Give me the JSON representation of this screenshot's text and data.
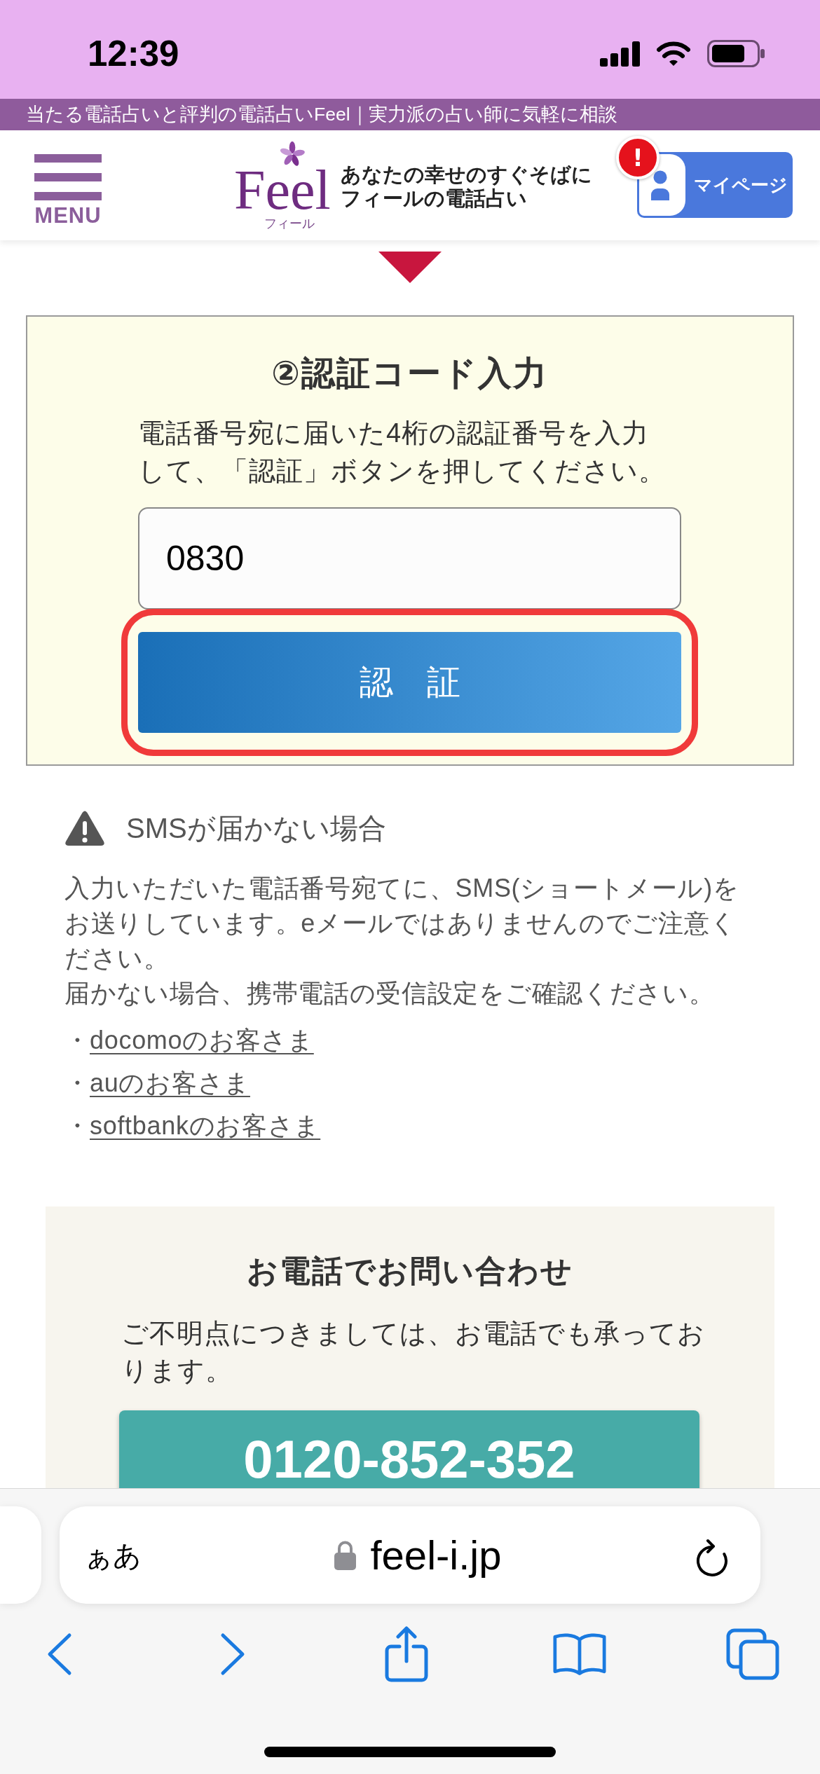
{
  "status_bar": {
    "time": "12:39"
  },
  "site_banner": {
    "text": "当たる電話占いと評判の電話占いFeel｜実力派の占い師に気軽に相談"
  },
  "header": {
    "menu_button": {
      "label": "MENU"
    },
    "logo": {
      "wordmark": "Feel",
      "reading": "フィール",
      "tagline": "あなたの幸せのすぐそばにフィールの電話占い"
    },
    "mypage_button": {
      "label": "マイページ",
      "badge": "!"
    }
  },
  "verification": {
    "title": "②認証コード入力",
    "instructions": "電話番号宛に届いた4桁の認証番号を入力して、「認証」ボタンを押してください。",
    "code_field": {
      "value": "0830"
    },
    "submit_button": {
      "label": "認　証",
      "highlighted": true
    }
  },
  "sms_help": {
    "heading": "SMSが届かない場合",
    "paragraphs": [
      "入力いただいた電話番号宛てに、SMS(ショートメール)をお送りしています。eメールではありませんのでご注意ください。",
      "届かない場合、携帯電話の受信設定をご確認ください。"
    ],
    "links": [
      {
        "bullet": "・",
        "label": "docomoのお客さま"
      },
      {
        "bullet": "・",
        "label": "auのお客さま"
      },
      {
        "bullet": "・",
        "label": "softbankのお客さま"
      }
    ]
  },
  "phone_contact": {
    "heading": "お電話でお問い合わせ",
    "text": "ご不明点につきましては、お電話でも承っております。",
    "phone_button": {
      "label": "0120-852-352"
    }
  },
  "browser": {
    "text_size_button": "ぁあ",
    "secure": true,
    "url": "feel-i.jp"
  }
}
